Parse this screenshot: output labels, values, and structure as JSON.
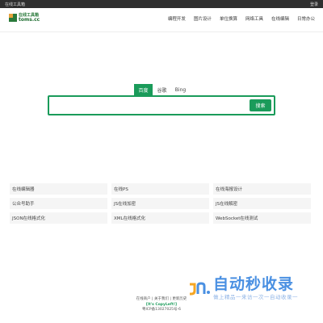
{
  "topbar": {
    "left": "在线工具箱",
    "right": "登录"
  },
  "logo": {
    "name": "在线工具箱",
    "domain": "toms.cc",
    "colors": [
      "#e6a23c",
      "#2a7a3b",
      "#2a7a3b",
      "#2a7a3b"
    ]
  },
  "nav": [
    "编程开发",
    "图片设计",
    "单位换算",
    "网络工具",
    "在线编辑",
    "日常办公"
  ],
  "search": {
    "tabs": [
      "百度",
      "谷歌",
      "Bing"
    ],
    "active_tab": "百度",
    "placeholder": "",
    "button": "搜索"
  },
  "tools": [
    "在线编辑器",
    "在线PS",
    "在线海报设计",
    "公众号助手",
    "JS在线加密",
    "JS在线解密",
    "JSON在线格式化",
    "XML在线格式化",
    "WebSocket在线测试"
  ],
  "footer": {
    "links": "在线商户 | 关于我们 | 更新历史",
    "copyleft": "[It's CopyLeft!]",
    "icp": "粤ICP备13027025号-6"
  },
  "watermark": {
    "title": "自动秒收录",
    "subtitle": "做上精品一来访一次一自动收录一"
  },
  "colors": {
    "accent": "#1a9b5a",
    "topbar": "#2f2f2f",
    "watermark": "#4a90e2"
  }
}
